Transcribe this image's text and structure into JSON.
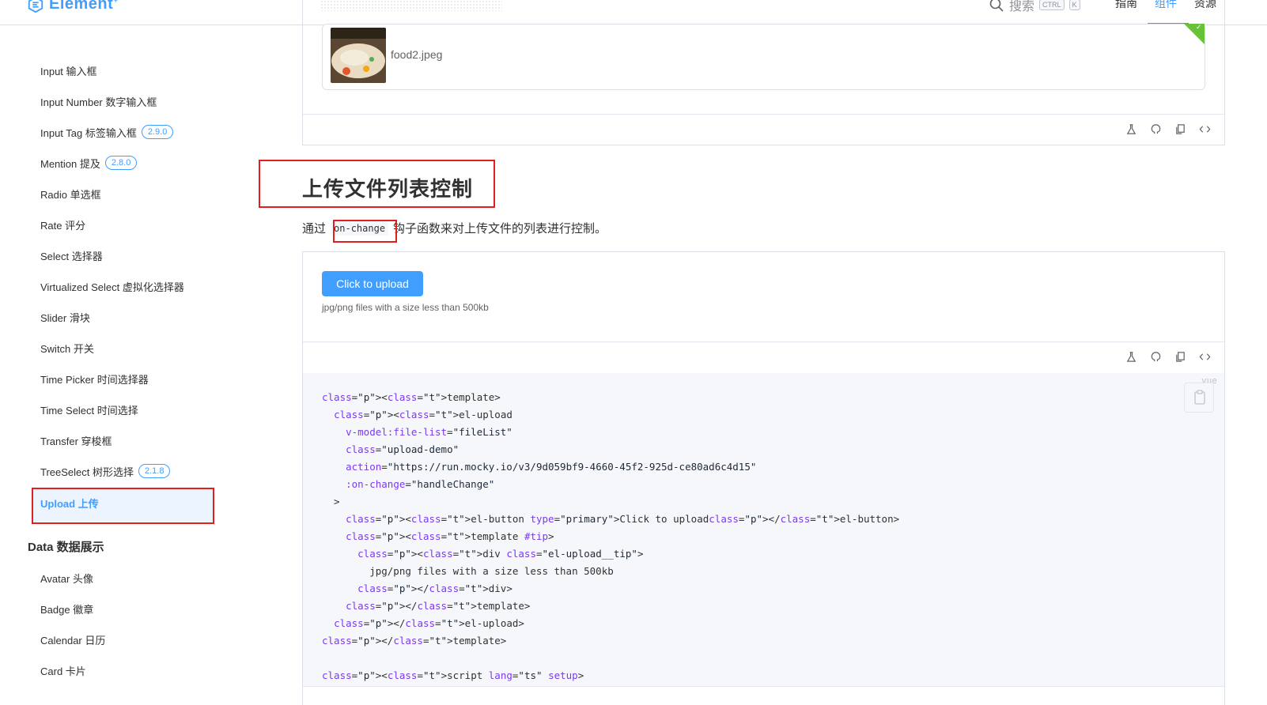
{
  "nav": {
    "logo": "Element",
    "logo_mark": "+",
    "search_placeholder": "搜索",
    "kbd_ctrl": "CTRL",
    "kbd_k": "K",
    "links": [
      "指南",
      "组件",
      "资源"
    ],
    "active_link": "组件",
    "accent": "#409eff"
  },
  "sidebar": {
    "items": [
      {
        "label": "Input 输入框",
        "badge": ""
      },
      {
        "label": "Input Number 数字输入框",
        "badge": ""
      },
      {
        "label": "Input Tag 标签输入框",
        "badge": "2.9.0"
      },
      {
        "label": "Mention 提及",
        "badge": "2.8.0"
      },
      {
        "label": "Radio 单选框",
        "badge": ""
      },
      {
        "label": "Rate 评分",
        "badge": ""
      },
      {
        "label": "Select 选择器",
        "badge": ""
      },
      {
        "label": "Virtualized Select 虚拟化选择器",
        "badge": ""
      },
      {
        "label": "Slider 滑块",
        "badge": ""
      },
      {
        "label": "Switch 开关",
        "badge": ""
      },
      {
        "label": "Time Picker 时间选择器",
        "badge": ""
      },
      {
        "label": "Time Select 时间选择",
        "badge": ""
      },
      {
        "label": "Transfer 穿梭框",
        "badge": ""
      },
      {
        "label": "TreeSelect 树形选择",
        "badge": "2.1.8"
      },
      {
        "label": "Upload 上传",
        "badge": "",
        "active": true
      }
    ],
    "group_title": "Data 数据展示",
    "group_items": [
      "Avatar 头像",
      "Badge 徽章",
      "Calendar 日历",
      "Card 卡片"
    ]
  },
  "demo_top": {
    "file_name": "food2.jpeg",
    "status_color": "#67c23a"
  },
  "section": {
    "title": "上传文件列表控制",
    "desc_prefix": "通过",
    "desc_code": "on-change",
    "desc_suffix": "钩子函数来对上传文件的列表进行控制。"
  },
  "demo": {
    "button_label": "Click to upload",
    "tip": "jpg/png files with a size less than 500kb",
    "code_lang": "vue"
  },
  "toolbar_icons": [
    "flask-icon",
    "github-icon",
    "copy-icon",
    "code-icon"
  ],
  "code": {
    "action_url": "https://run.mocky.io/v3/9d059bf9-4660-45f2-925d-ce80ad6c4d15",
    "lines": [
      "<template>",
      "  <el-upload",
      "    v-model:file-list=\"fileList\"",
      "    class=\"upload-demo\"",
      "    action=\"https://run.mocky.io/v3/9d059bf9-4660-45f2-925d-ce80ad6c4d15\"",
      "    :on-change=\"handleChange\"",
      "  >",
      "    <el-button type=\"primary\">Click to upload</el-button>",
      "    <template #tip>",
      "      <div class=\"el-upload__tip\">",
      "        jpg/png files with a size less than 500kb",
      "      </div>",
      "    </template>",
      "  </el-upload>",
      "</template>",
      "",
      "<script lang=\"ts\" setup>"
    ]
  }
}
